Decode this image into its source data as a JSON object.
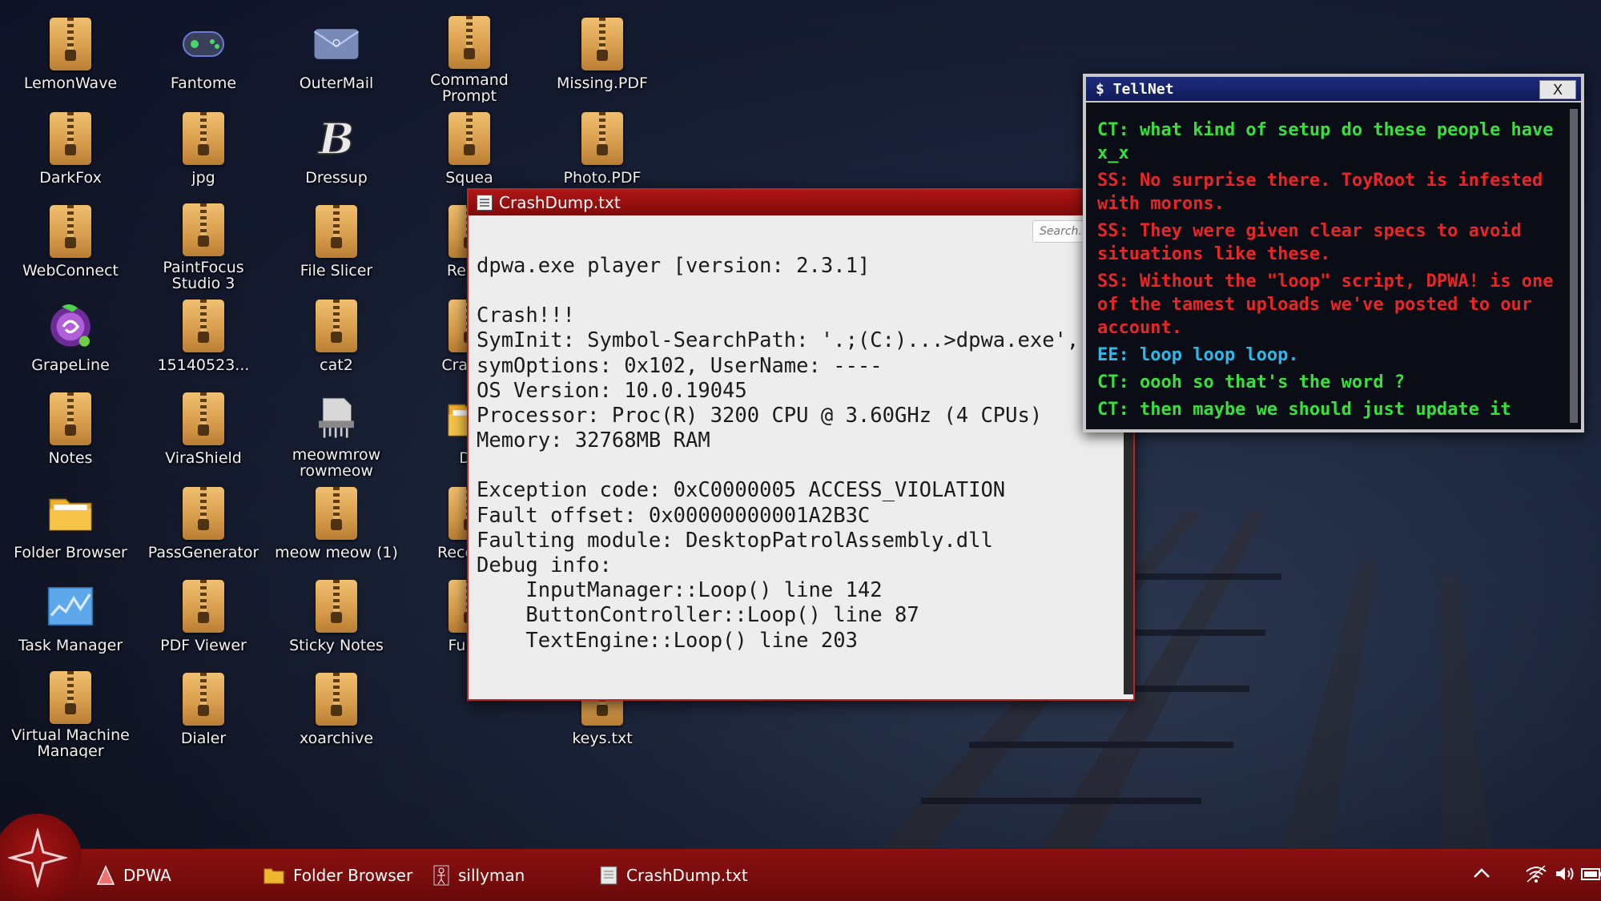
{
  "desktop": {
    "icons": [
      {
        "label": "LemonWave",
        "icon": "zip-folder-icon"
      },
      {
        "label": "Fantome",
        "icon": "gamepad-icon"
      },
      {
        "label": "OuterMail",
        "icon": "envelope-icon"
      },
      {
        "label": "Command Prompt",
        "icon": "zip-folder-icon"
      },
      {
        "label": "Missing.PDF",
        "icon": "zip-folder-icon"
      },
      {
        "label": "DarkFox",
        "icon": "zip-folder-icon"
      },
      {
        "label": "jpg",
        "icon": "zip-folder-icon"
      },
      {
        "label": "Dressup",
        "icon": "b-logo-icon"
      },
      {
        "label": "Squea",
        "icon": "zip-folder-icon"
      },
      {
        "label": "Photo.PDF",
        "icon": "zip-folder-icon"
      },
      {
        "label": "WebConnect",
        "icon": "zip-folder-icon"
      },
      {
        "label": "PaintFocus Studio 3",
        "icon": "zip-folder-icon"
      },
      {
        "label": "File Slicer",
        "icon": "zip-folder-icon"
      },
      {
        "label": "Recyc",
        "icon": "zip-folder-icon"
      },
      {
        "label": "GrapeLine",
        "icon": "grape-icon"
      },
      {
        "label": "15140523...",
        "icon": "zip-folder-icon"
      },
      {
        "label": "cat2",
        "icon": "zip-folder-icon"
      },
      {
        "label": "CrashD",
        "icon": "zip-folder-icon"
      },
      {
        "label": "Notes",
        "icon": "zip-folder-icon"
      },
      {
        "label": "ViraShield",
        "icon": "zip-folder-icon"
      },
      {
        "label": "meowmrow rowmeow",
        "icon": "shredder-icon"
      },
      {
        "label": "DF",
        "icon": "folder-icon"
      },
      {
        "label": "Folder Browser",
        "icon": "folder-icon"
      },
      {
        "label": "PassGenerator",
        "icon": "zip-folder-icon"
      },
      {
        "label": "meow meow (1)",
        "icon": "zip-folder-icon"
      },
      {
        "label": "Receivin",
        "icon": "zip-folder-icon"
      },
      {
        "label": "Task Manager",
        "icon": "chart-icon"
      },
      {
        "label": "PDF Viewer",
        "icon": "zip-folder-icon"
      },
      {
        "label": "Sticky Notes",
        "icon": "zip-folder-icon"
      },
      {
        "label": "Furna",
        "icon": "zip-folder-icon"
      },
      {
        "label": "Virtual Machine Manager",
        "icon": "zip-folder-icon"
      },
      {
        "label": "Dialer",
        "icon": "zip-folder-icon"
      },
      {
        "label": "xoarchive",
        "icon": "zip-folder-icon"
      },
      {
        "label": "keys.txt",
        "icon": "zip-folder-icon"
      }
    ]
  },
  "crashdump": {
    "title": "CrashDump.txt",
    "search_placeholder": "Search...",
    "lines": [
      "dpwa.exe player [version: 2.3.1]",
      "",
      "Crash!!!",
      "SymInit: Symbol-SearchPath: '.;(C:)...>dpwa.exe',",
      "symOptions: 0x102, UserName: ----",
      "OS Version: 10.0.19045",
      "Processor: Proc(R) 3200 CPU @ 3.60GHz (4 CPUs)",
      "Memory: 32768MB RAM",
      "",
      "Exception code: 0xC0000005 ACCESS_VIOLATION",
      "Fault offset: 0x00000000001A2B3C",
      "Faulting module: DesktopPatrolAssembly.dll",
      "Debug info:",
      "    InputManager::Loop() line 142",
      "    ButtonController::Loop() line 87",
      "    TextEngine::Loop() line 203"
    ]
  },
  "tellnet": {
    "title": "$ TellNet",
    "close_label": "X",
    "messages": [
      {
        "speaker": "CT",
        "text": "CT: what kind of setup do these people have x_x"
      },
      {
        "speaker": "SS",
        "text": "SS: No surprise there. ToyRoot is infested with morons."
      },
      {
        "speaker": "SS",
        "text": "SS: They were given clear specs to avoid situations like these."
      },
      {
        "speaker": "SS",
        "text": "SS: Without the \"loop\" script, DPWA! is one of the tamest uploads we've posted to our account."
      },
      {
        "speaker": "EE",
        "text": "EE: loop loop loop."
      },
      {
        "speaker": "CT",
        "text": "CT: oooh so that's the word ?"
      },
      {
        "speaker": "CT",
        "text": "CT: then maybe we should just update it"
      }
    ]
  },
  "taskbar": {
    "items": [
      {
        "label": "DPWA",
        "icon": "dpwa-icon"
      },
      {
        "label": "Folder Browser",
        "icon": "folder-icon"
      },
      {
        "label": "sillyman",
        "icon": "stickman-icon"
      },
      {
        "label": "CrashDump.txt",
        "icon": "file-icon"
      }
    ],
    "tray": [
      "chevron-up-icon",
      "wifi-icon",
      "volume-icon",
      "battery-icon"
    ]
  },
  "colors": {
    "taskbar": "#7a0d0d",
    "tellnet_ct": "#39e03b",
    "tellnet_ss": "#e82626",
    "tellnet_ee": "#2fb8e8"
  }
}
